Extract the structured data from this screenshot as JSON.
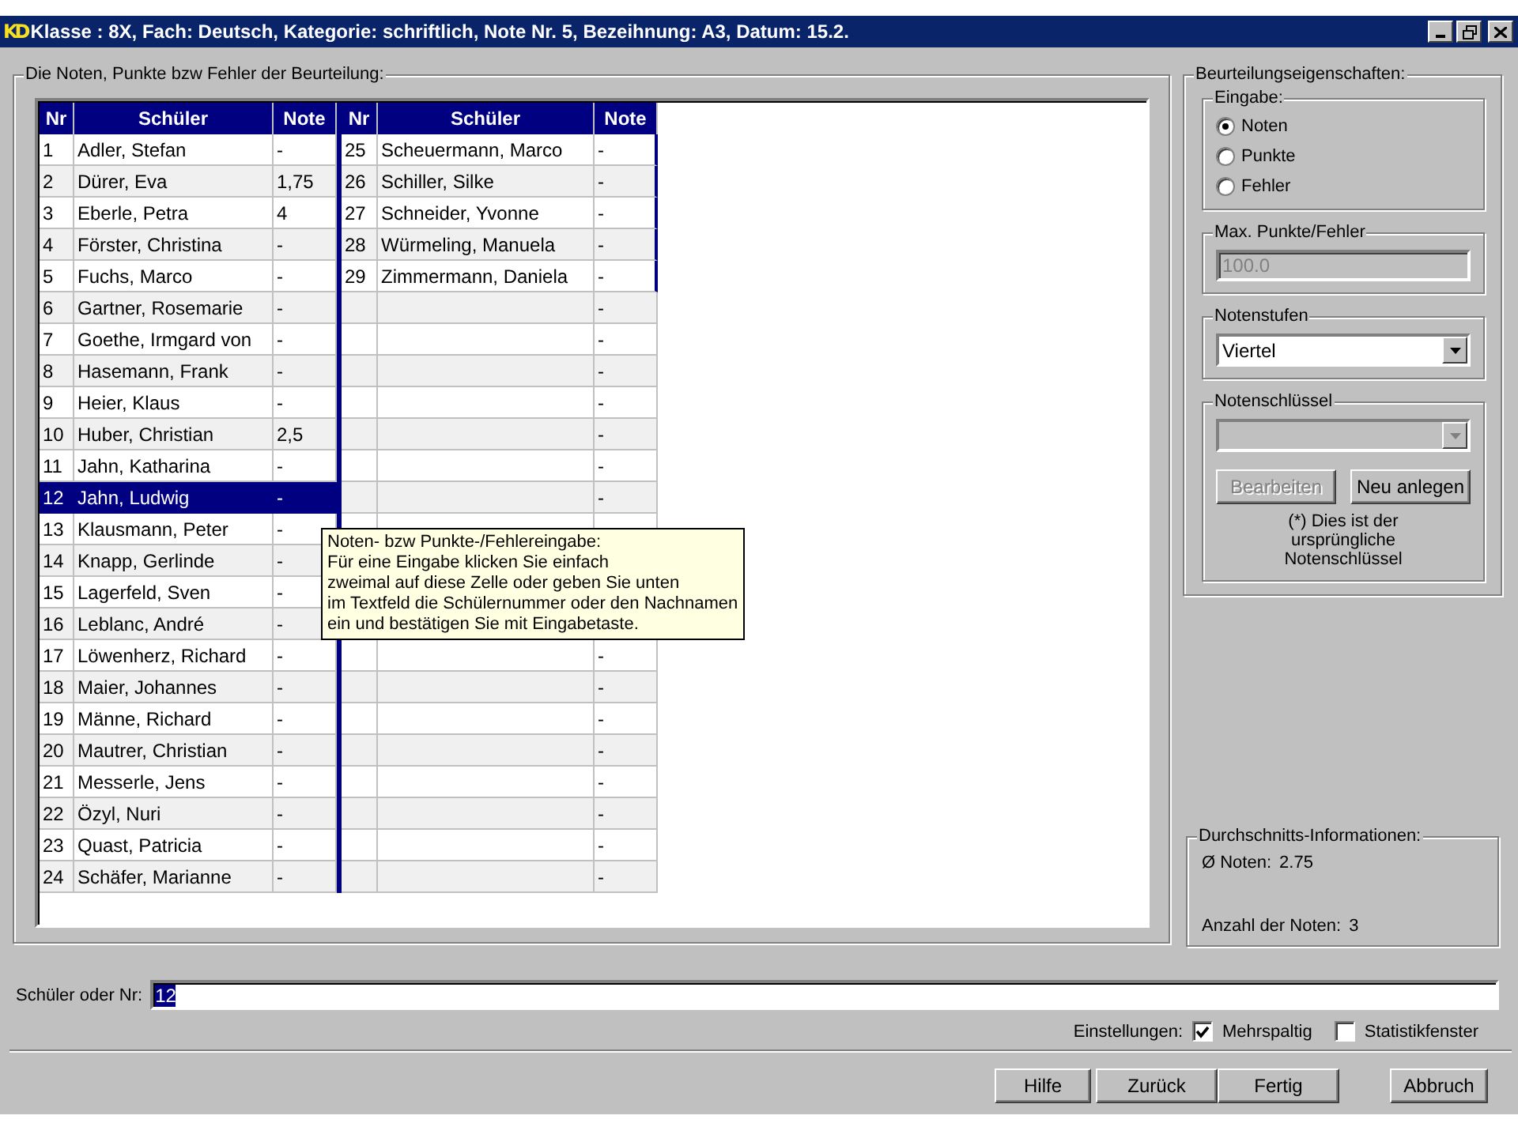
{
  "window": {
    "logo": "KD",
    "title": "Klasse : 8X, Fach: Deutsch, Kategorie: schriftlich, Note Nr. 5, Bezeihnung: A3, Datum: 15.2."
  },
  "grades_panel": {
    "legend": "Die Noten, Punkte bzw Fehler der Beurteilung:",
    "groups": [
      {
        "columns": [
          "Nr",
          "Schüler",
          "Note"
        ],
        "rows": [
          {
            "nr": "1",
            "name": "Adler, Stefan",
            "note": "-",
            "selected": false
          },
          {
            "nr": "2",
            "name": "Dürer, Eva",
            "note": "1,75",
            "selected": false
          },
          {
            "nr": "3",
            "name": "Eberle, Petra",
            "note": "4",
            "selected": false
          },
          {
            "nr": "4",
            "name": "Förster, Christina",
            "note": "-",
            "selected": false
          },
          {
            "nr": "5",
            "name": "Fuchs, Marco",
            "note": "-",
            "selected": false
          },
          {
            "nr": "6",
            "name": "Gartner, Rosemarie",
            "note": "-",
            "selected": false
          },
          {
            "nr": "7",
            "name": "Goethe, Irmgard von",
            "note": "-",
            "selected": false
          },
          {
            "nr": "8",
            "name": "Hasemann, Frank",
            "note": "-",
            "selected": false
          },
          {
            "nr": "9",
            "name": "Heier, Klaus",
            "note": "-",
            "selected": false
          },
          {
            "nr": "10",
            "name": "Huber, Christian",
            "note": "2,5",
            "selected": false
          },
          {
            "nr": "11",
            "name": "Jahn, Katharina",
            "note": "-",
            "selected": false
          },
          {
            "nr": "12",
            "name": "Jahn, Ludwig",
            "note": "-",
            "selected": true
          },
          {
            "nr": "13",
            "name": "Klausmann, Peter",
            "note": "-",
            "selected": false
          },
          {
            "nr": "14",
            "name": "Knapp, Gerlinde",
            "note": "-",
            "selected": false
          },
          {
            "nr": "15",
            "name": "Lagerfeld, Sven",
            "note": "-",
            "selected": false
          },
          {
            "nr": "16",
            "name": "Leblanc, André",
            "note": "-",
            "selected": false
          },
          {
            "nr": "17",
            "name": "Löwenherz, Richard",
            "note": "-",
            "selected": false
          },
          {
            "nr": "18",
            "name": "Maier, Johannes",
            "note": "-",
            "selected": false
          },
          {
            "nr": "19",
            "name": "Männe, Richard",
            "note": "-",
            "selected": false
          },
          {
            "nr": "20",
            "name": "Mautrer, Christian",
            "note": "-",
            "selected": false
          },
          {
            "nr": "21",
            "name": "Messerle, Jens",
            "note": "-",
            "selected": false
          },
          {
            "nr": "22",
            "name": "Özyl, Nuri",
            "note": "-",
            "selected": false
          },
          {
            "nr": "23",
            "name": "Quast, Patricia",
            "note": "-",
            "selected": false
          },
          {
            "nr": "24",
            "name": "Schäfer, Marianne",
            "note": "-",
            "selected": false
          }
        ]
      },
      {
        "columns": [
          "Nr",
          "Schüler",
          "Note"
        ],
        "rows": [
          {
            "nr": "25",
            "name": "Scheuermann, Marco",
            "note": "-",
            "selected": false
          },
          {
            "nr": "26",
            "name": "Schiller, Silke",
            "note": "-",
            "selected": false
          },
          {
            "nr": "27",
            "name": "Schneider, Yvonne",
            "note": "-",
            "selected": false
          },
          {
            "nr": "28",
            "name": "Würmeling, Manuela",
            "note": "-",
            "selected": false
          },
          {
            "nr": "29",
            "name": "Zimmermann, Daniela",
            "note": "-",
            "selected": false
          },
          {
            "note": "-",
            "selected": false
          },
          {
            "note": "-",
            "selected": false
          },
          {
            "note": "-",
            "selected": false
          },
          {
            "note": "-",
            "selected": false
          },
          {
            "note": "-",
            "selected": false
          },
          {
            "note": "-",
            "selected": false
          },
          {
            "note": "-",
            "selected": false
          },
          {},
          {},
          {},
          {},
          {
            "note": "-",
            "selected": false
          },
          {
            "note": "-",
            "selected": false
          },
          {
            "note": "-",
            "selected": false
          },
          {
            "note": "-",
            "selected": false
          },
          {
            "note": "-",
            "selected": false
          },
          {
            "note": "-",
            "selected": false
          },
          {
            "note": "-",
            "selected": false
          },
          {
            "note": "-",
            "selected": false
          }
        ]
      }
    ],
    "tooltip": "Noten- bzw Punkte-/Fehlereingabe:\nFür eine Eingabe klicken Sie einfach\nzweimal auf diese Zelle oder geben Sie unten\nim Textfeld die Schülernummer oder den Nachnamen\nein und bestätigen Sie mit Eingabetaste."
  },
  "properties": {
    "legend": "Beurteilungseigenschaften:",
    "input": {
      "legend": "Eingabe:",
      "options": [
        {
          "label": "Noten",
          "selected": true
        },
        {
          "label": "Punkte",
          "selected": false
        },
        {
          "label": "Fehler",
          "selected": false
        }
      ]
    },
    "max": {
      "legend": "Max. Punkte/Fehler",
      "value": "100.0",
      "disabled": true
    },
    "levels": {
      "legend": "Notenstufen",
      "value": "Viertel",
      "disabled": false
    },
    "key": {
      "legend": "Notenschlüssel",
      "disabled": true,
      "buttons": [
        {
          "label": "Bearbeiten",
          "disabled": true
        },
        {
          "label": "Neu anlegen",
          "disabled": false
        }
      ],
      "note": "(*) Dies ist der ursprüngliche Notenschlüssel"
    }
  },
  "averages": {
    "legend": "Durchschnitts-Informationen:",
    "items": [
      {
        "label": "Ø Noten:",
        "value": "2.75"
      },
      {
        "label": "Anzahl der Noten:",
        "value": "3"
      }
    ]
  },
  "search": {
    "label": "Schüler oder Nr:",
    "value": "12"
  },
  "settings": {
    "label": "Einstellungen:",
    "options": [
      {
        "label": "Mehrspaltig",
        "checked": true
      },
      {
        "label": "Statistikfenster",
        "checked": false
      }
    ]
  },
  "buttons": [
    {
      "label": "Hilfe"
    },
    {
      "label": "Zurück"
    },
    {
      "label": "Fertig"
    },
    {
      "label": "Abbruch"
    }
  ]
}
